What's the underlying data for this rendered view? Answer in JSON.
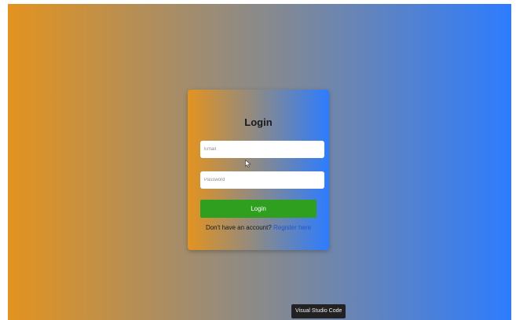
{
  "colors": {
    "gradient_start": "#e3931f",
    "gradient_mid": "#8a8a8a",
    "gradient_end": "#2d7cff",
    "button": "#2e9f1f",
    "link": "#1e56c8"
  },
  "login_card": {
    "title": "Login",
    "email_placeholder": "Email",
    "password_placeholder": "Password",
    "button_label": "Login",
    "prompt_text": "Don't have an account?",
    "register_link": "Register here"
  },
  "taskbar_tooltip": {
    "label": "Visual Studio Code"
  },
  "pointer": {
    "icon": "arrow-cursor-icon"
  }
}
